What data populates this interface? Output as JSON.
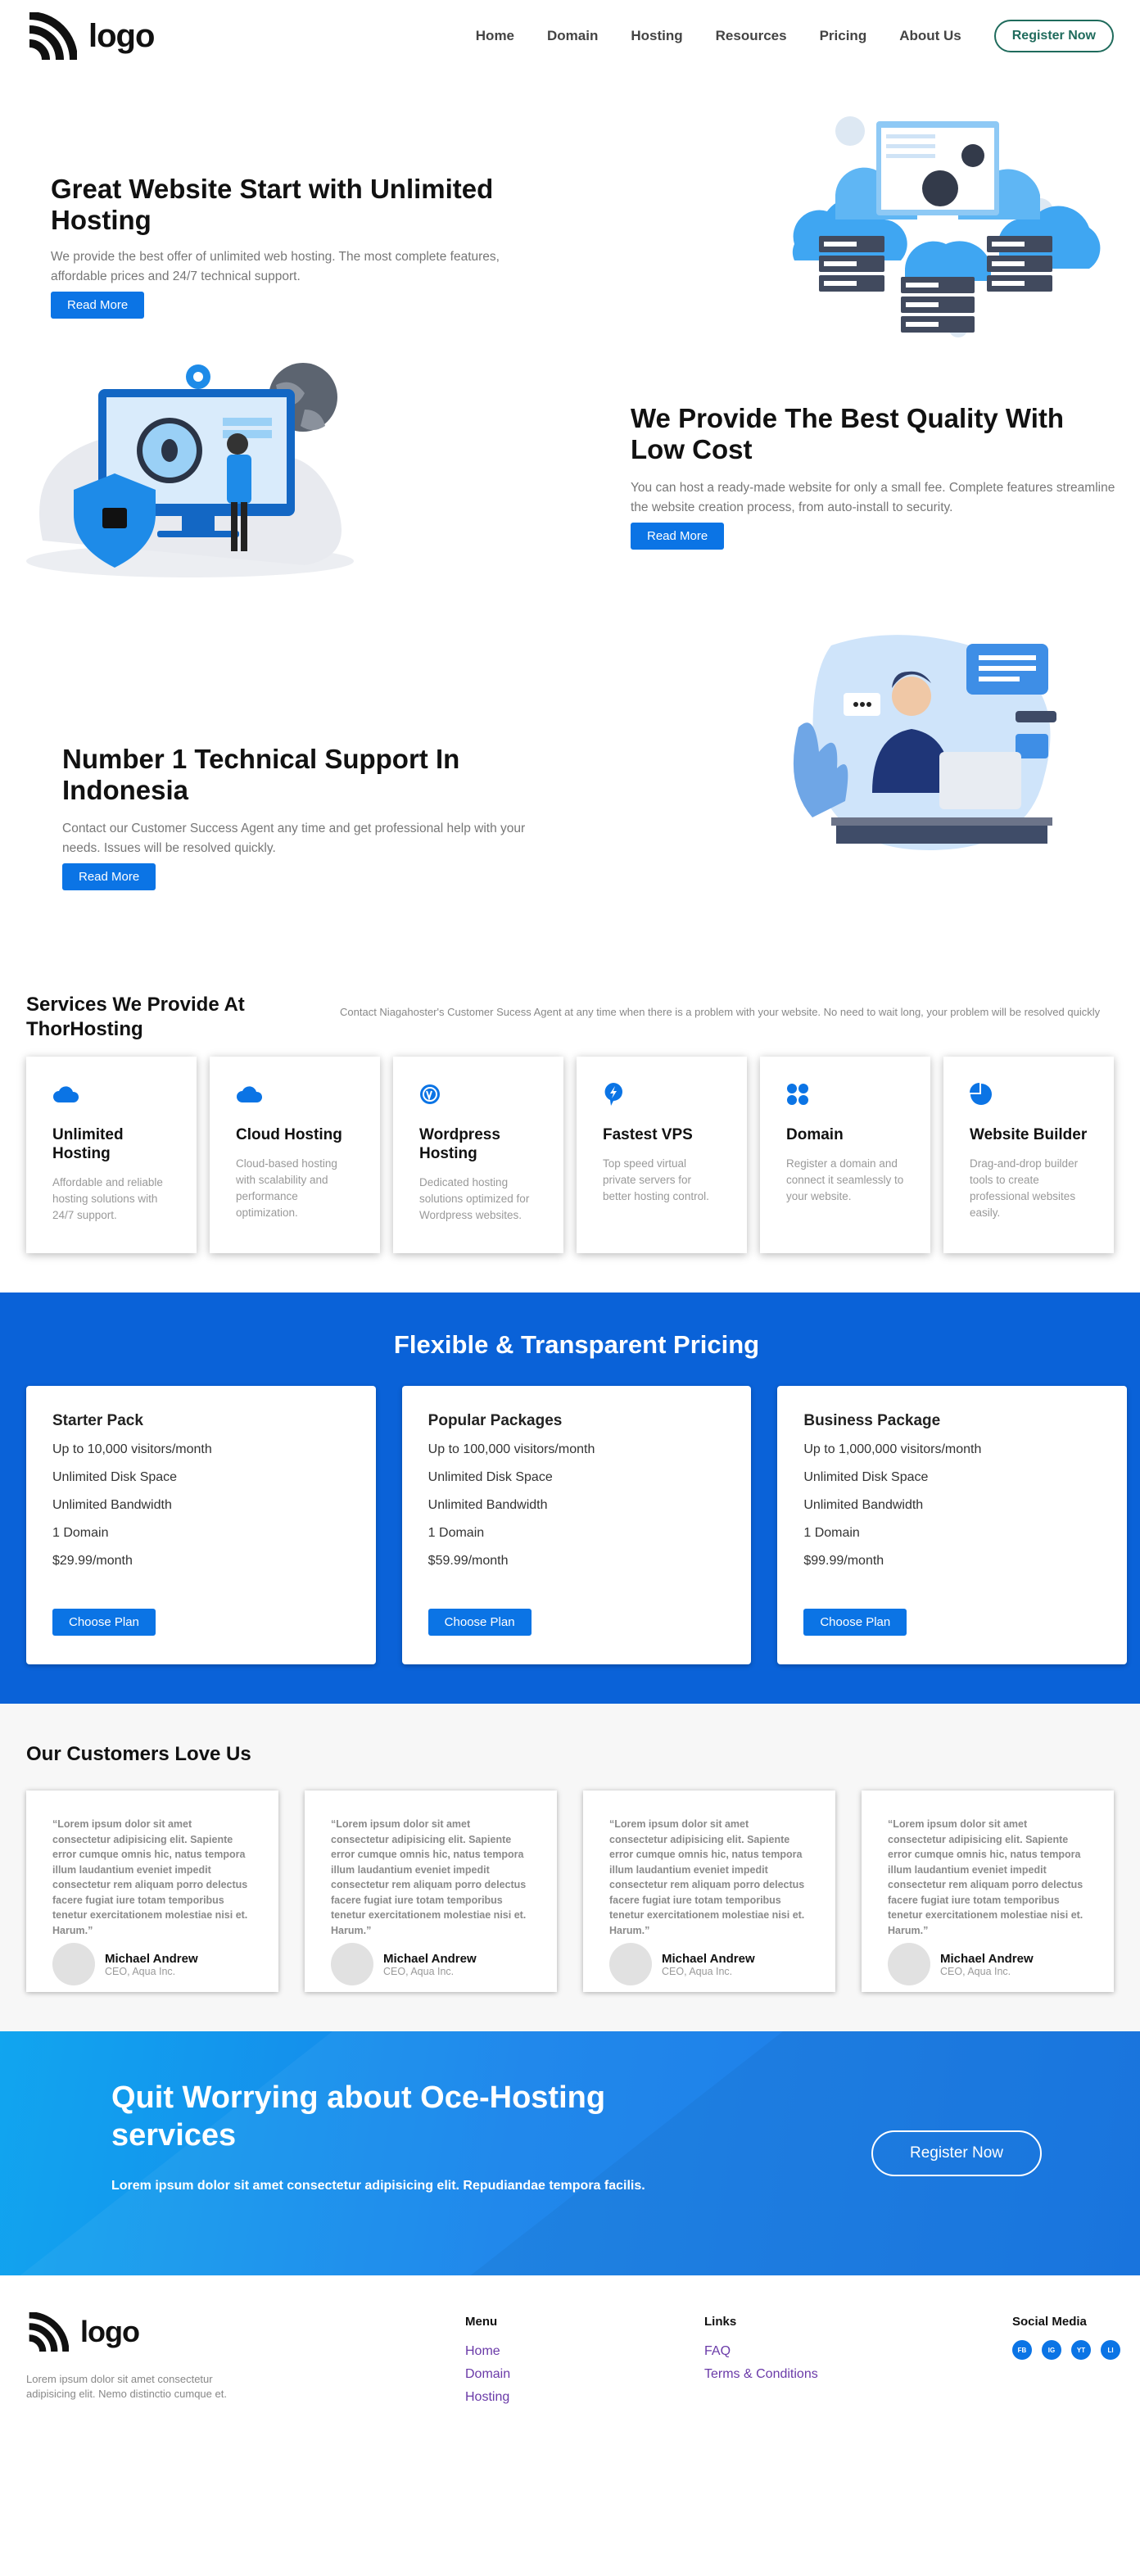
{
  "nav": {
    "logo_text": "logo",
    "links": [
      "Home",
      "Domain",
      "Hosting",
      "Resources",
      "Pricing",
      "About Us"
    ],
    "register_label": "Register Now"
  },
  "hero1": {
    "title": "Great Website Start with Unlimited Hosting",
    "desc": "We provide the best offer of unlimited web hosting. The most complete features, affordable prices and 24/7 technical support.",
    "button": "Read More"
  },
  "hero2": {
    "title": "We Provide The Best Quality With Low Cost",
    "desc": "You can host a ready-made website for only a small fee. Complete features streamline the website creation process, from auto-install to security.",
    "button": "Read More"
  },
  "hero3": {
    "title": "Number 1 Technical Support In Indonesia",
    "desc": "Contact our Customer Success Agent any time and get professional help with your needs. Issues will be resolved quickly.",
    "button": "Read More"
  },
  "services": {
    "title": "Services We Provide At ThorHosting",
    "desc": "Contact Niagahoster's Customer Sucess Agent at any time when there is a problem with your website. No need to wait long, your problem will be resolved quickly",
    "items": [
      {
        "title": "Unlimited Hosting",
        "desc": "Affordable and reliable hosting solutions with 24/7 support.",
        "icon": "cloud-icon"
      },
      {
        "title": "Cloud Hosting",
        "desc": "Cloud-based hosting with scalability and performance optimization.",
        "icon": "cloud-icon"
      },
      {
        "title": "Wordpress Hosting",
        "desc": "Dedicated hosting solutions optimized for Wordpress websites.",
        "icon": "wordpress-icon"
      },
      {
        "title": "Fastest VPS",
        "desc": "Top speed virtual private servers for better hosting control.",
        "icon": "bolt-icon"
      },
      {
        "title": "Domain",
        "desc": "Register a domain and connect it seamlessly to your website.",
        "icon": "grid-icon"
      },
      {
        "title": "Website Builder",
        "desc": "Drag-and-drop builder tools to create professional websites easily.",
        "icon": "pie-icon"
      }
    ]
  },
  "pricing": {
    "title": "Flexible & Transparent Pricing",
    "plans": [
      {
        "name": "Starter Pack",
        "features": [
          "Up to 10,000 visitors/month",
          "Unlimited Disk Space",
          "Unlimited Bandwidth",
          "1 Domain",
          "$29.99/month"
        ],
        "button": "Choose Plan"
      },
      {
        "name": "Popular Packages",
        "features": [
          "Up to 100,000 visitors/month",
          "Unlimited Disk Space",
          "Unlimited Bandwidth",
          "1 Domain",
          "$59.99/month"
        ],
        "button": "Choose Plan"
      },
      {
        "name": "Business Package",
        "features": [
          "Up to 1,000,000 visitors/month",
          "Unlimited Disk Space",
          "Unlimited Bandwidth",
          "1 Domain",
          "$99.99/month"
        ],
        "button": "Choose Plan"
      }
    ]
  },
  "testimonials": {
    "title": "Our Customers Love Us",
    "items": [
      {
        "quote": "“Lorem ipsum dolor sit amet consectetur adipisicing elit. Sapiente error cumque omnis hic, natus tempora illum laudantium eveniet impedit consectetur rem aliquam porro delectus facere fugiat iure totam temporibus tenetur exercitationem molestiae nisi et. Harum.”",
        "name": "Michael Andrew",
        "role": "CEO, Aqua Inc."
      },
      {
        "quote": "“Lorem ipsum dolor sit amet consectetur adipisicing elit. Sapiente error cumque omnis hic, natus tempora illum laudantium eveniet impedit consectetur rem aliquam porro delectus facere fugiat iure totam temporibus tenetur exercitationem molestiae nisi et. Harum.”",
        "name": "Michael Andrew",
        "role": "CEO, Aqua Inc."
      },
      {
        "quote": "“Lorem ipsum dolor sit amet consectetur adipisicing elit. Sapiente error cumque omnis hic, natus tempora illum laudantium eveniet impedit consectetur rem aliquam porro delectus facere fugiat iure totam temporibus tenetur exercitationem molestiae nisi et. Harum.”",
        "name": "Michael Andrew",
        "role": "CEO, Aqua Inc."
      },
      {
        "quote": "“Lorem ipsum dolor sit amet consectetur adipisicing elit. Sapiente error cumque omnis hic, natus tempora illum laudantium eveniet impedit consectetur rem aliquam porro delectus facere fugiat iure totam temporibus tenetur exercitationem molestiae nisi et. Harum.”",
        "name": "Michael Andrew",
        "role": "CEO, Aqua Inc."
      }
    ]
  },
  "cta": {
    "title": "Quit Worrying about Oce-Hosting services",
    "desc": "Lorem ipsum dolor sit amet consectetur adipisicing elit. Repudiandae tempora facilis.",
    "button": "Register Now"
  },
  "footer": {
    "logo_text": "logo",
    "desc": "Lorem ipsum dolor sit amet consectetur adipisicing elit. Nemo distinctio cumque et.",
    "menu_title": "Menu",
    "menu": [
      "Home",
      "Domain",
      "Hosting"
    ],
    "links_title": "Links",
    "links": [
      "FAQ",
      "Terms & Conditions"
    ],
    "social_title": "Social Media",
    "socials": [
      "FB",
      "IG",
      "YT",
      "LI"
    ]
  },
  "colors": {
    "primary": "#0b74e5",
    "pricing_bg": "#0a62d8",
    "nav_button": "#1f6b5c",
    "footer_link": "#6a3aa8"
  }
}
